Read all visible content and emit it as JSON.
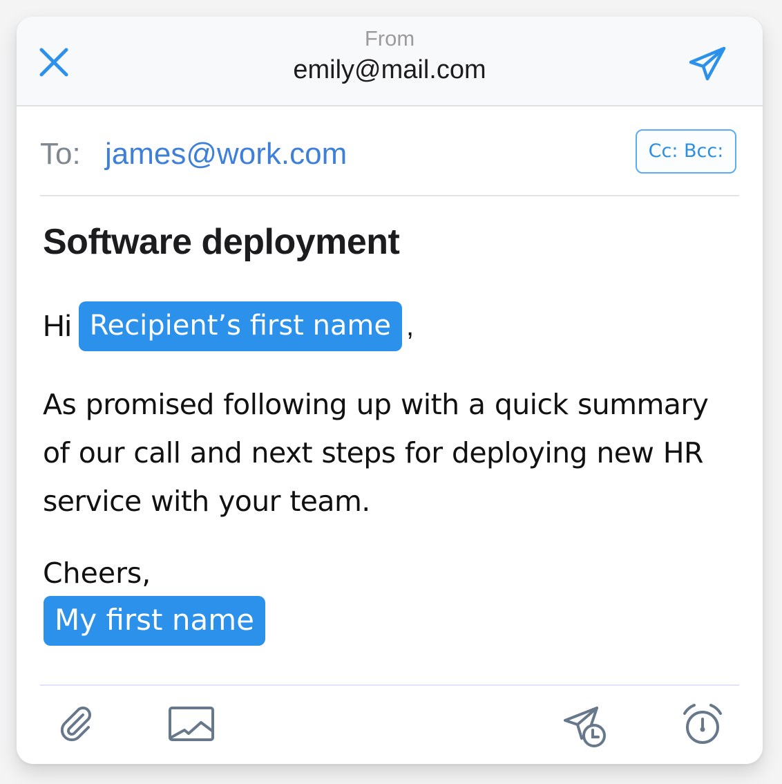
{
  "header": {
    "from_label": "From",
    "from_email": "emily@mail.com",
    "close_icon": "close-icon",
    "send_icon": "send-icon"
  },
  "recipients": {
    "to_label": "To:",
    "to_email": "james@work.com",
    "cc_bcc_label": "Cc: Bcc:"
  },
  "message": {
    "subject": "Software deployment",
    "greeting_prefix": "Hi",
    "recipient_token": "Recipient’s first name",
    "greeting_suffix": ",",
    "paragraph": "As promised following up with a quick summary of our call and next steps for deploying new HR service with your team.",
    "signoff": "Cheers,",
    "signature_token": "My first name"
  },
  "toolbar": {
    "items": [
      {
        "icon": "paperclip-icon",
        "label": "Attach file"
      },
      {
        "icon": "image-icon",
        "label": "Insert image"
      },
      {
        "icon": "schedule-send-icon",
        "label": "Send later"
      },
      {
        "icon": "alarm-clock-icon",
        "label": "Reminder"
      }
    ]
  },
  "colors": {
    "accent": "#2b91ea",
    "link": "#3d7fd9",
    "icon_gray": "#66788a",
    "header_bg": "#f8f9fb"
  }
}
